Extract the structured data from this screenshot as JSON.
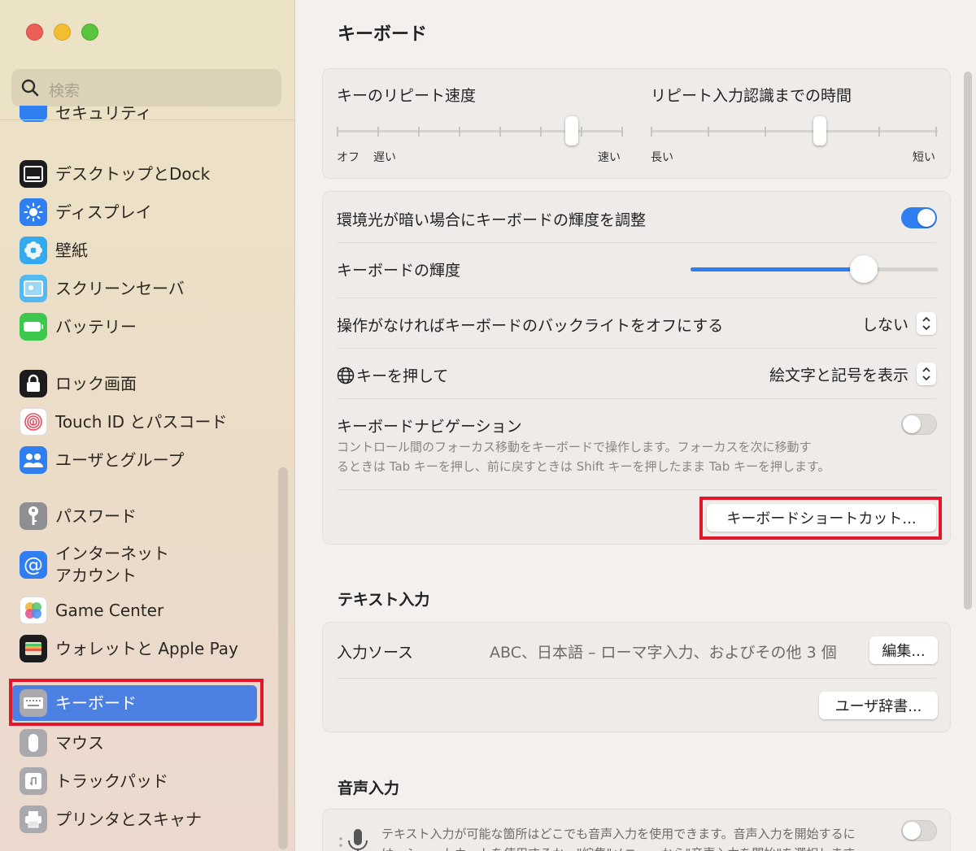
{
  "window": {
    "title": "キーボード"
  },
  "search": {
    "placeholder": "検索",
    "icon": "magnifier"
  },
  "sidebar": {
    "partial_item": "セキュリティ",
    "groups": [
      [
        {
          "label": "デスクトップとDock",
          "icon": "dock-icon",
          "color": "#1f1f1f"
        },
        {
          "label": "ディスプレイ",
          "icon": "display-icon",
          "color": "#2f7ff0"
        },
        {
          "label": "壁紙",
          "icon": "wallpaper-icon",
          "color": "#33a9ec"
        },
        {
          "label": "スクリーンセーバ",
          "icon": "screensaver-icon",
          "color": "#4db6ef"
        },
        {
          "label": "バッテリー",
          "icon": "battery-icon",
          "color": "#3cc84c"
        }
      ],
      [
        {
          "label": "ロック画面",
          "icon": "lock-icon",
          "color": "#1f1f1f"
        },
        {
          "label": "Touch ID とパスコード",
          "icon": "fingerprint-icon",
          "color": "#ffffff"
        },
        {
          "label": "ユーザとグループ",
          "icon": "users-icon",
          "color": "#2f7ff0"
        }
      ],
      [
        {
          "label": "パスワード",
          "icon": "key-icon",
          "color": "#8e8e93"
        },
        {
          "label": "インターネット",
          "label2": "アカウント",
          "icon": "at-icon",
          "color": "#2f7ff0"
        },
        {
          "label": "Game Center",
          "icon": "gamecenter-icon",
          "color": "#ffffff"
        },
        {
          "label": "ウォレットと Apple Pay",
          "icon": "wallet-icon",
          "color": "#1f1f1f"
        }
      ],
      [
        {
          "label": "キーボード",
          "icon": "keyboard-icon",
          "color": "#8e8e93",
          "selected": true
        },
        {
          "label": "マウス",
          "icon": "mouse-icon",
          "color": "#8e8e93"
        },
        {
          "label": "トラックパッド",
          "icon": "trackpad-icon",
          "color": "#8e8e93"
        },
        {
          "label": "プリンタとスキャナ",
          "icon": "printer-icon",
          "color": "#8e8e93"
        }
      ]
    ]
  },
  "repeat": {
    "speed_label": "キーのリピート速度",
    "speed_min": "オフ",
    "speed_slow": "遅い",
    "speed_fast": "速い",
    "speed_level": 0.82,
    "delay_label": "リピート入力認識までの時間",
    "delay_long": "長い",
    "delay_short": "短い",
    "delay_level": 0.59
  },
  "settings": {
    "ambient_label": "環境光が暗い場合にキーボードの輝度を調整",
    "ambient_on": true,
    "brightness_label": "キーボードの輝度",
    "brightness_level": 0.7,
    "backlight_label": "操作がなければキーボードのバックライトをオフにする",
    "backlight_value": "しない",
    "globe_label": "キーを押して",
    "globe_value": "絵文字と記号を表示",
    "nav_label": "キーボードナビゲーション",
    "nav_desc_1": "コントロール間のフォーカス移動をキーボードで操作します。フォーカスを次に移動す",
    "nav_desc_2": "るときは Tab キーを押し、前に戻すときは Shift キーを押したまま Tab キーを押します。",
    "nav_on": false,
    "shortcuts_button": "キーボードショートカット..."
  },
  "text_input": {
    "title": "テキスト入力",
    "source_label": "入力ソース",
    "source_value": "ABC、日本語 – ローマ字入力、およびその他 3 個",
    "edit_button": "編集...",
    "dict_button": "ユーザ辞書..."
  },
  "dictation": {
    "title": "音声入力",
    "desc_1": "テキスト入力が可能な箇所はどこでも音声入力を使用できます。音声入力を開始するに",
    "desc_2": "は、ショートカットを使用するか、\"編集\"メニューから\"音声入力を開始\"を選択します。",
    "on": false
  },
  "colors": {
    "accent": "#2f7ff0",
    "selection": "#4c80e3",
    "highlight": "#e3172c"
  }
}
